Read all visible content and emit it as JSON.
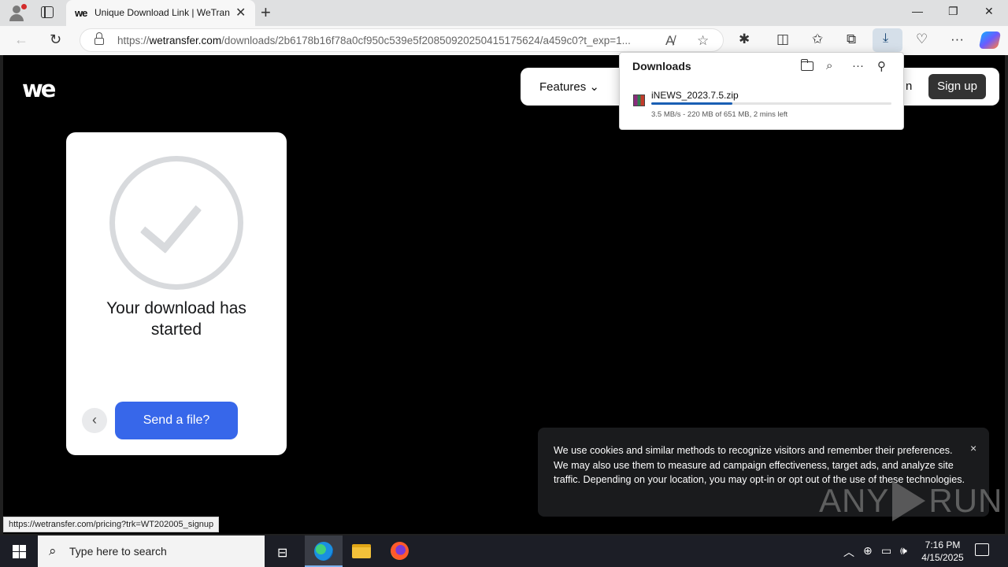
{
  "browser": {
    "tab_title": "Unique Download Link | WeTransfer",
    "tab_favicon": "we",
    "url_prefix": "https://",
    "url_host": "wetransfer.com",
    "url_path": "/downloads/2b6178b16f78a0cf950c539e5f20850920250415175624/a459c0?t_exp=1...",
    "status_url": "https://wetransfer.com/pricing?trk=WT202005_signup"
  },
  "downloads_panel": {
    "title": "Downloads",
    "file_name": "iNEWS_2023.7.5.zip",
    "detail": "3.5 MB/s - 220 MB of 651 MB, 2 mins left",
    "progress_fraction": 0.338
  },
  "site": {
    "logo": "we",
    "nav_features": "Features",
    "nav_login_fragment": "n",
    "signup": "Sign up"
  },
  "card": {
    "title": "Your download has started",
    "send_button": "Send a file?",
    "back_glyph": "‹"
  },
  "cookie": {
    "text": "We use cookies and similar methods to recognize visitors and remember their preferences. We may also use them to measure ad campaign effectiveness, target ads, and analyze site traffic. Depending on your location, you may opt-in or opt out of the use of these technologies.",
    "close": "×"
  },
  "watermark": {
    "left": "ANY",
    "right": "RUN"
  },
  "taskbar": {
    "search_placeholder": "Type here to search",
    "time": "7:16 PM",
    "date": "4/15/2025"
  }
}
